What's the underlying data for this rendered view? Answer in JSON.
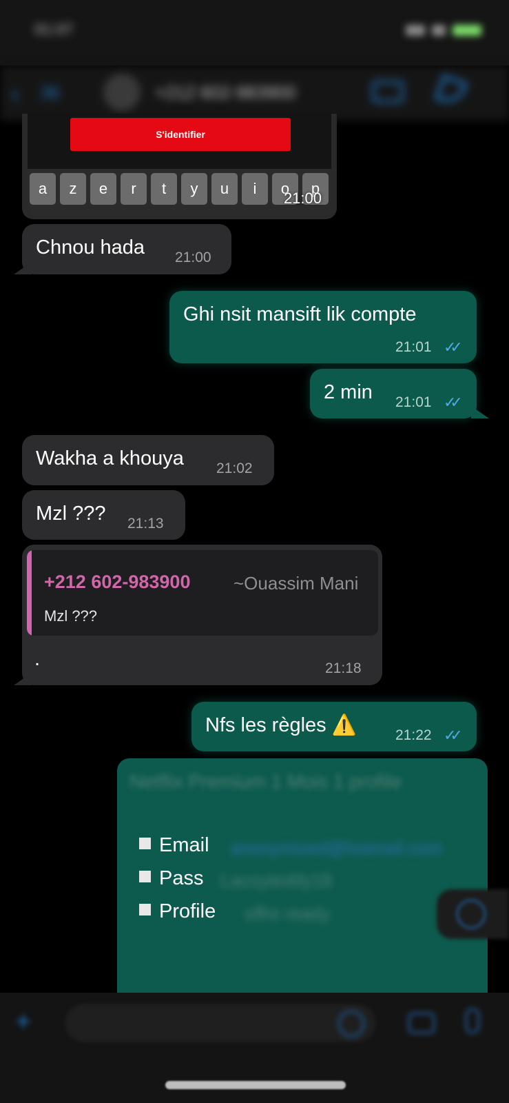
{
  "status_bar": {
    "time": "01:07"
  },
  "header": {
    "back_glyph": "‹",
    "unread_count": "36",
    "contact": "+212 602-983900"
  },
  "image_message": {
    "button_label": "S'identifier",
    "keys": [
      "a",
      "z",
      "e",
      "r",
      "t",
      "y",
      "u",
      "i",
      "o",
      "p"
    ],
    "time": "21:00"
  },
  "messages": [
    {
      "text": "Chnou hada",
      "time": "21:00",
      "direction": "incoming"
    },
    {
      "text": "Ghi nsit mansift lik compte",
      "time": "21:01",
      "direction": "outgoing",
      "read": true
    },
    {
      "text": "2 min",
      "time": "21:01",
      "direction": "outgoing",
      "read": true
    },
    {
      "text": "Wakha a khouya",
      "time": "21:02",
      "direction": "incoming"
    },
    {
      "text": "Mzl ???",
      "time": "21:13",
      "direction": "incoming"
    },
    {
      "text": ".",
      "time": "21:18",
      "direction": "incoming",
      "reply": {
        "number": "+212 602-983900",
        "name": "~Ouassim Mani",
        "text": "Mzl ???"
      }
    },
    {
      "text": "Nfs les règles ⚠️",
      "time": "21:22",
      "direction": "outgoing",
      "read": true
    }
  ],
  "account_message": {
    "title": "Netflix Premium 1 Mois 1 profile",
    "email_label": "Email",
    "email_value": "anonymized@hotmail.com",
    "pass_label": "Pass",
    "pass_value": "Lacoyteddy18",
    "profile_label": "Profile",
    "profile_value": "offre ready"
  },
  "read_ticks": "✓✓",
  "colors": {
    "incoming_bubble": "#2c2c2e",
    "outgoing_bubble": "#0b5a4c",
    "read_ticks": "#53a8e6",
    "quote_accent": "#d264b0",
    "login_button": "#e50914"
  }
}
